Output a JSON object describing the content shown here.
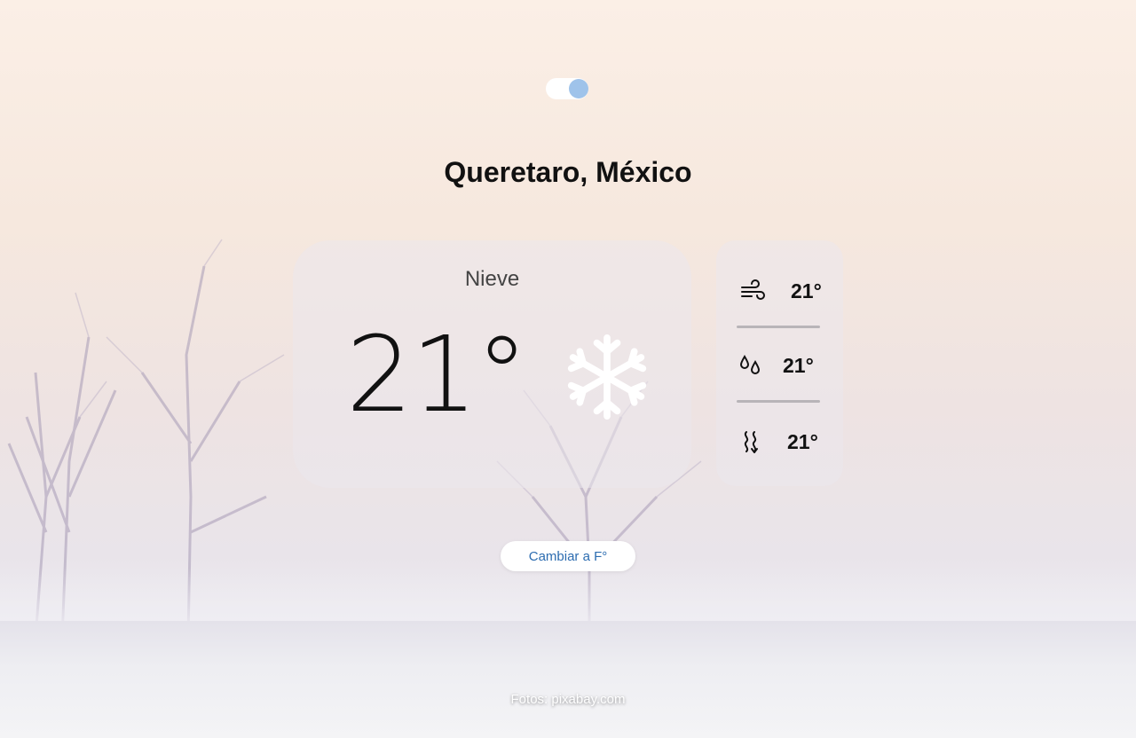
{
  "location": {
    "city": "Queretaro, México"
  },
  "theme_toggle": {
    "state": "on"
  },
  "weather": {
    "condition": "Nieve",
    "temperature": "21°",
    "condition_icon": "snowflake-icon"
  },
  "stats": [
    {
      "icon": "wind-icon",
      "value": "21°"
    },
    {
      "icon": "humidity-icon",
      "value": "21°"
    },
    {
      "icon": "heat-icon",
      "value": "21°"
    }
  ],
  "unit_button": {
    "label": "Cambiar a F°"
  },
  "footer": {
    "credit": "Fotos: pixabay.com"
  },
  "colors": {
    "toggle_knob": "#9fc3ea",
    "button_text": "#2c6cb0",
    "card_bg": "rgba(235,232,236,0.55)"
  }
}
